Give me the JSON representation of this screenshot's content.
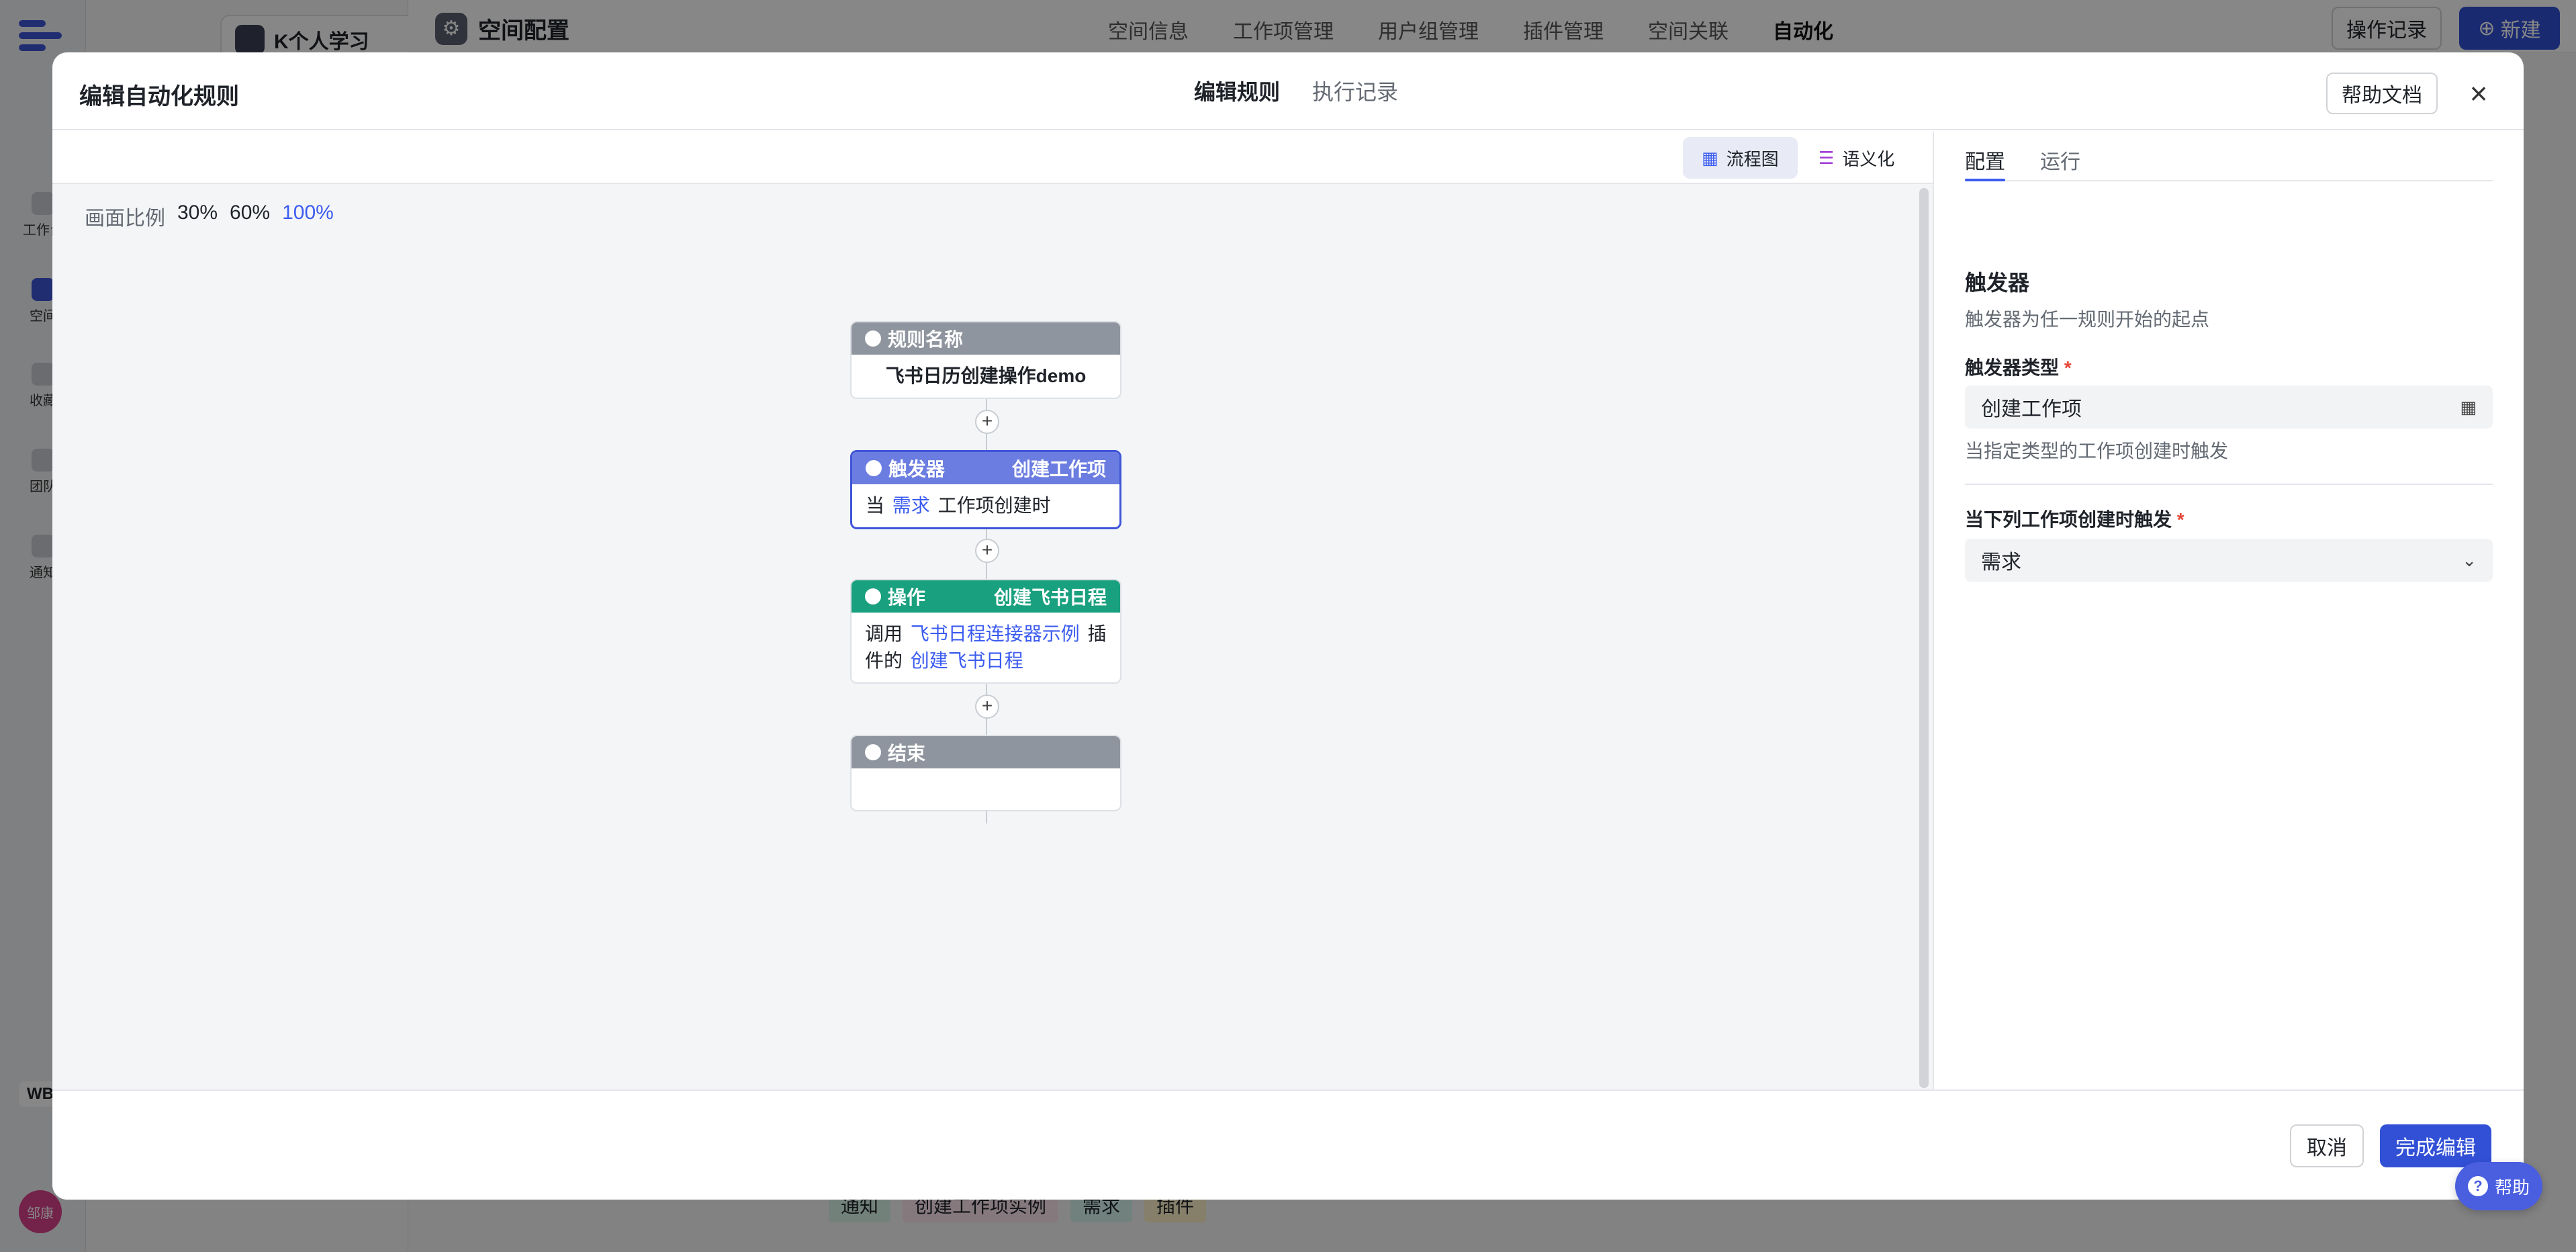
{
  "app": {
    "workspace_name": "K个人学习",
    "page_title": "空间配置",
    "nav": [
      "空间信息",
      "工作项管理",
      "用户组管理",
      "插件管理",
      "空间关联",
      "自动化"
    ],
    "active_nav": "自动化",
    "op_log_button": "操作记录",
    "new_button": "新建",
    "sidebar_items": [
      "工作台",
      "空间",
      "收藏",
      "团队",
      "通知"
    ],
    "wb_badge": "WB",
    "user_avatar": "邹康",
    "bg_tags": [
      "通知",
      "创建工作项实例",
      "需求",
      "插件"
    ]
  },
  "modal": {
    "title": "编辑自动化规则",
    "tabs": [
      "编辑规则",
      "执行记录"
    ],
    "help_doc_button": "帮助文档",
    "close_icon": "close-icon"
  },
  "canvas": {
    "view_flowchart": "流程图",
    "view_semantic": "语义化",
    "ratio_label": "画面比例",
    "ratio_30": "30%",
    "ratio_60": "60%",
    "ratio_100": "100%",
    "rule_node": {
      "header": "规则名称",
      "body": "飞书日历创建操作demo"
    },
    "trigger_node": {
      "header": "触发器",
      "type": "创建工作项",
      "prefix": "当",
      "link": "需求",
      "suffix": "工作项创建时"
    },
    "action_node": {
      "header": "操作",
      "type": "创建飞书日程",
      "prefix": "调用",
      "link1": "飞书日程连接器示例",
      "mid": "插件的",
      "link2": "创建飞书日程"
    },
    "end_node": {
      "header": "结束"
    },
    "add_symbol": "+"
  },
  "panel": {
    "tabs": [
      "配置",
      "运行"
    ],
    "section_title": "触发器",
    "section_desc": "触发器为任一规则开始的起点",
    "trigger_type_label": "触发器类型",
    "trigger_type_value": "创建工作项",
    "trigger_type_hint": "当指定类型的工作项创建时触发",
    "work_item_label": "当下列工作项创建时触发",
    "work_item_value": "需求",
    "required_mark": "*"
  },
  "footer": {
    "cancel": "取消",
    "done": "完成编辑",
    "help": "帮助"
  },
  "colors": {
    "primary": "#3250d6",
    "trigger_header": "#6b7de0",
    "action_header": "#19a07e",
    "gray_header": "#8f959e"
  }
}
